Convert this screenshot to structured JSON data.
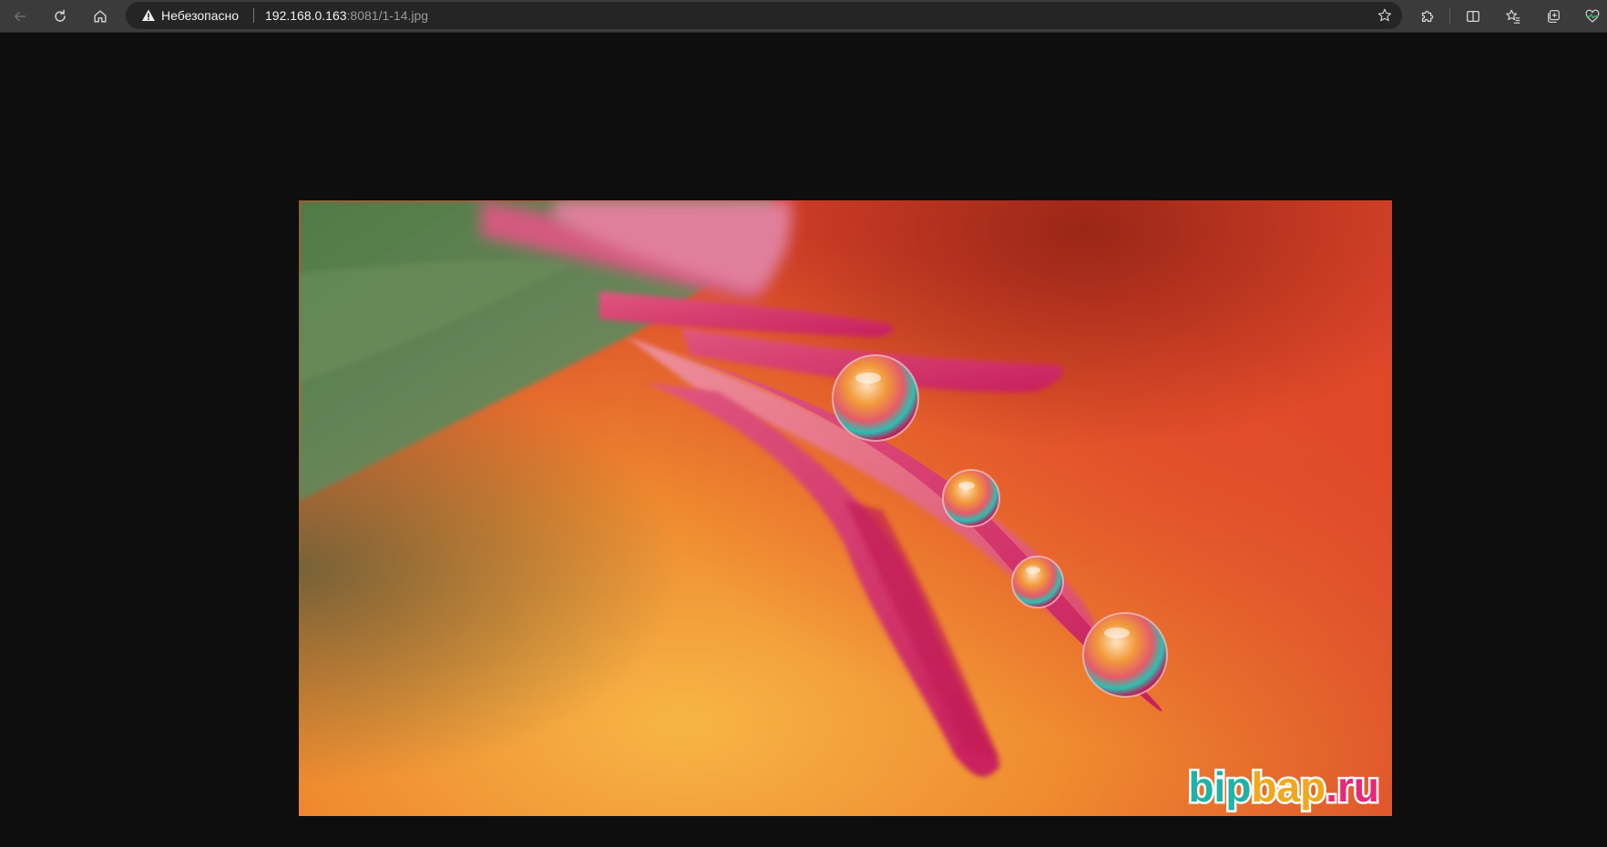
{
  "browser": {
    "security_label": "Небезопасно",
    "url_host": "192.168.0.163",
    "url_rest": ":8081/1-14.jpg",
    "icons": {
      "back": "arrow-left-icon",
      "reload": "reload-icon",
      "home": "home-icon",
      "warning": "warning-triangle-icon",
      "favorite": "star-icon",
      "extensions": "puzzle-icon",
      "split_screen": "split-screen-icon",
      "favorites": "favorites-list-icon",
      "collections": "collections-icon",
      "performance": "heartbeat-icon"
    }
  },
  "image": {
    "watermark": "bipbap.ru",
    "watermark_colors": [
      "#1fb3a6",
      "#e6287a",
      "#f2a81d",
      "#e6287a",
      "#1fb3a6"
    ]
  },
  "colors": {
    "toolbar": "#3b3b3b",
    "addressbar": "#252525",
    "page_background": "#0e0e0e"
  }
}
